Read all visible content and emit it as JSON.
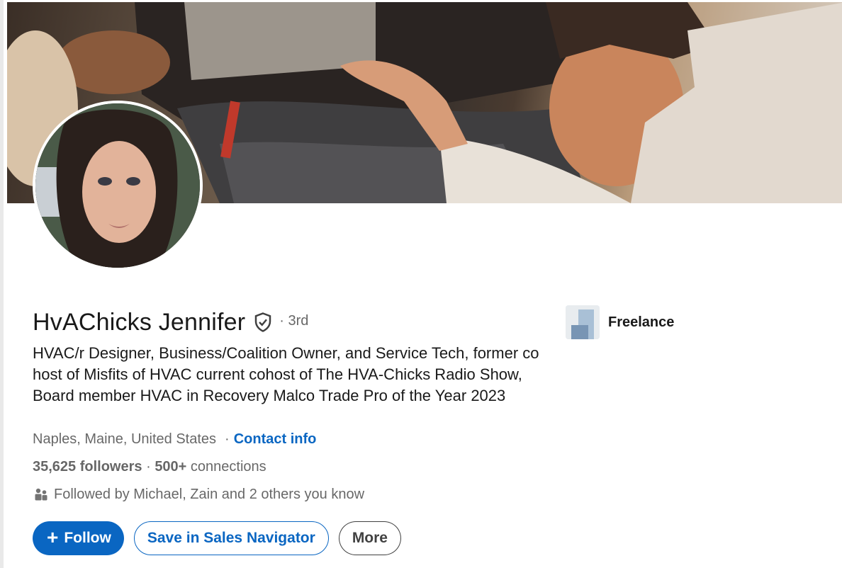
{
  "profile": {
    "name": "HvAChicks Jennifer",
    "degree": "· 3rd",
    "headline": "HVAC/r Designer, Business/Coalition Owner, and Service Tech, former co host of Misfits of HVAC current cohost of The HVA-Chicks Radio Show, Board member HVAC in Recovery Malco Trade Pro of the Year 2023",
    "location": "Naples, Maine, United States",
    "separator": "·",
    "contact_info": "Contact info",
    "followers": "35,625 followers",
    "stats_separator": " · ",
    "connections_count": "500+",
    "connections_label": " connections",
    "followed_by": "Followed by Michael, Zain and 2 others you know"
  },
  "company": {
    "name": "Freelance"
  },
  "actions": {
    "follow_icon": "+",
    "follow": "Follow",
    "save_sales_nav": "Save in Sales Navigator",
    "more": "More"
  },
  "icons": {
    "verified": "shield-check-icon",
    "people": "people-icon",
    "plus": "plus-icon"
  },
  "colors": {
    "accent": "#0a66c2",
    "muted_text": "#666666"
  }
}
